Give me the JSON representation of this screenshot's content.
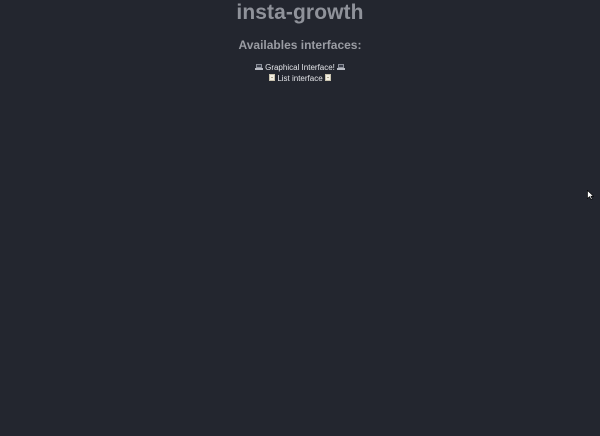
{
  "app": {
    "title": "insta-growth"
  },
  "interfaces": {
    "heading": "Availables interfaces:",
    "items": [
      {
        "label": "Graphical Interface!",
        "icon": "laptop-icon"
      },
      {
        "label": "List interface",
        "icon": "page-icon"
      }
    ]
  },
  "colors": {
    "background": "#23262f",
    "title": "#8f929a",
    "link_text": "#e3e4e8"
  }
}
